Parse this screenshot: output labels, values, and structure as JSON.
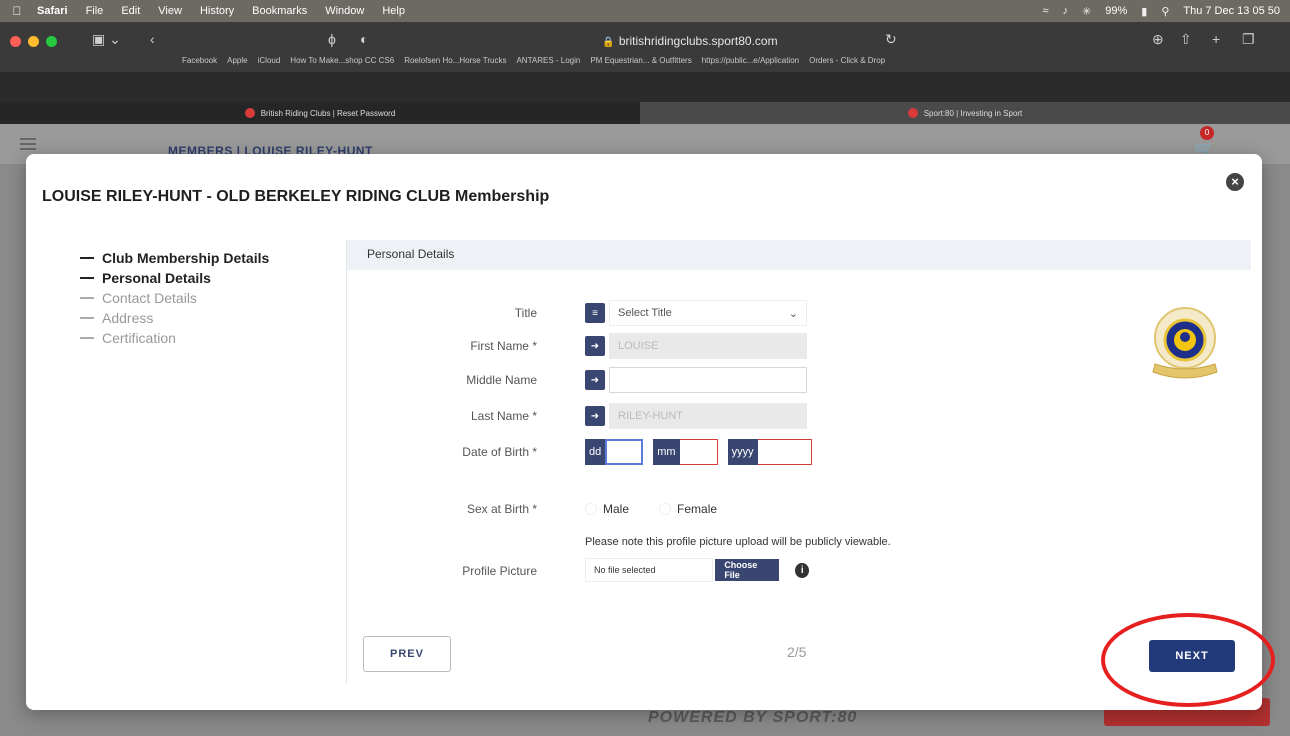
{
  "menubar": {
    "app": "Safari",
    "items": [
      "File",
      "Edit",
      "View",
      "History",
      "Bookmarks",
      "Window",
      "Help"
    ],
    "battery": "99%",
    "datetime": "Thu 7 Dec 13 05 50"
  },
  "browser": {
    "url": "britishridingclubs.sport80.com",
    "bookmarks": [
      "Facebook",
      "Apple",
      "iCloud",
      "How To Make...shop CC CS6",
      "Roelofsen Ho...Horse Trucks",
      "ANTARES - Login",
      "PM Equestrian... & Outfitters",
      "https://public...e/Application",
      "Orders - Click & Drop"
    ],
    "tabs": [
      {
        "label": "British Riding Clubs | Reset Password"
      },
      {
        "label": "Sport:80 | Investing in Sport"
      }
    ]
  },
  "page": {
    "breadcrumb": "MEMBERS  |  LOUISE RILEY-HUNT",
    "cart_count": "0",
    "footer": "POWERED BY SPORT:80"
  },
  "modal": {
    "title": "LOUISE RILEY-HUNT - OLD BERKELEY RIDING CLUB Membership",
    "steps": [
      {
        "label": "Club Membership Details"
      },
      {
        "label": "Personal Details"
      },
      {
        "label": "Contact Details"
      },
      {
        "label": "Address"
      },
      {
        "label": "Certification"
      }
    ],
    "panel_title": "Personal Details",
    "form": {
      "title_label": "Title",
      "title_placeholder": "Select Title",
      "first_name_label": "First Name *",
      "first_name_value": "LOUISE",
      "middle_name_label": "Middle Name",
      "middle_name_value": "",
      "last_name_label": "Last Name *",
      "last_name_value": "RILEY-HUNT",
      "dob_label": "Date of Birth *",
      "dob_day": "dd",
      "dob_month": "mm",
      "dob_year": "yyyy",
      "sex_label": "Sex at Birth *",
      "sex_options": [
        "Male",
        "Female"
      ],
      "profile_note": "Please note this profile picture upload will be publicly viewable.",
      "profile_label": "Profile Picture",
      "file_status": "No file selected",
      "choose_file": "Choose File"
    },
    "prev_label": "PREV",
    "pager": "2/5",
    "next_label": "NEXT"
  },
  "colors": {
    "primary": "#22397a",
    "icon_bg": "#3a4672",
    "annotation": "#e5201f"
  }
}
